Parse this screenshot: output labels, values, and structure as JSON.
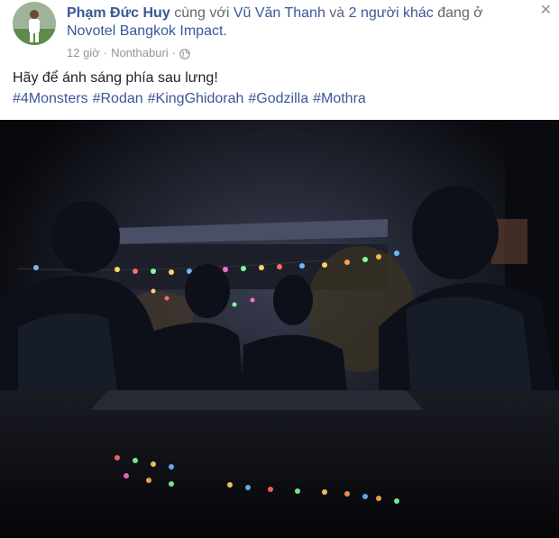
{
  "post": {
    "author": "Phạm Đức Huy",
    "with_word": "cùng với",
    "tagged_friend": "Vũ Văn Thanh",
    "and_word": "và",
    "others": "2 người khác",
    "at_word": "đang ở",
    "location": "Novotel Bangkok Impact.",
    "time": "12 giờ",
    "separator": "·",
    "place": "Nonthaburi",
    "privacy_icon": "globe-icon",
    "text": "Hãy để ánh sáng phía sau lưng!",
    "hashtags": [
      "#4Monsters",
      "#Rodan",
      "#KingGhidorah",
      "#Godzilla",
      "#Mothra"
    ]
  },
  "close_icon": "close-icon",
  "colors": {
    "link": "#385898",
    "meta": "#90949c",
    "text": "#1d2129"
  }
}
